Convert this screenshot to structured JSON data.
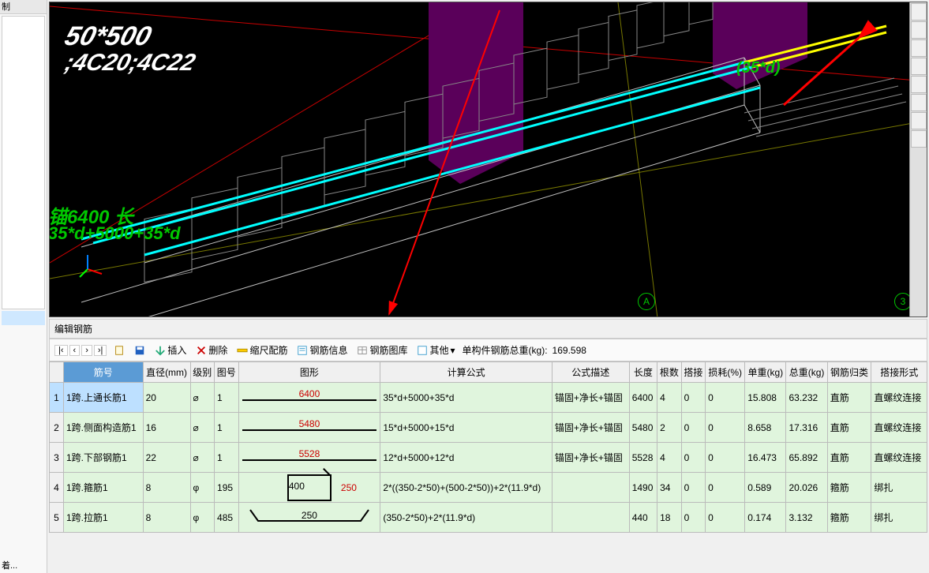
{
  "left": {
    "top_label": "制",
    "bottom_label": "着..."
  },
  "viewport": {
    "dim": "50*500",
    "rebar": ";4C20;4C22",
    "anchor_txt": "锚6400  长",
    "formula": "35*d+5000+35*d",
    "annot": "(35*d)",
    "axisA": "A",
    "axis3": "3"
  },
  "panel": {
    "title": "编辑钢筋"
  },
  "toolbar": {
    "nav": [
      "|‹",
      "‹",
      "›",
      "›|"
    ],
    "insert": "插入",
    "delete": "删除",
    "scale": "缩尺配筋",
    "info": "钢筋信息",
    "lib": "钢筋图库",
    "other": "其他",
    "weight_label": "单构件钢筋总重(kg):",
    "weight_value": "169.598"
  },
  "columns": [
    "",
    "筋号",
    "直径(mm)",
    "级别",
    "图号",
    "图形",
    "计算公式",
    "公式描述",
    "长度",
    "根数",
    "搭接",
    "损耗(%)",
    "单重(kg)",
    "总重(kg)",
    "钢筋归类",
    "搭接形式"
  ],
  "rows": [
    {
      "n": "1",
      "name": "1跨.上通长筋1",
      "dia": "20",
      "lvl": "⌀",
      "tu": "1",
      "shape": {
        "type": "line",
        "val": "6400"
      },
      "formula": "35*d+5000+35*d",
      "desc": "锚固+净长+锚固",
      "len": "6400",
      "cnt": "4",
      "lap": "0",
      "loss": "0",
      "uw": "15.808",
      "tw": "63.232",
      "cat": "直筋",
      "lapf": "直螺纹连接",
      "sel": true
    },
    {
      "n": "2",
      "name": "1跨.侧面构造筋1",
      "dia": "16",
      "lvl": "⌀",
      "tu": "1",
      "shape": {
        "type": "line",
        "val": "5480"
      },
      "formula": "15*d+5000+15*d",
      "desc": "锚固+净长+锚固",
      "len": "5480",
      "cnt": "2",
      "lap": "0",
      "loss": "0",
      "uw": "8.658",
      "tw": "17.316",
      "cat": "直筋",
      "lapf": "直螺纹连接"
    },
    {
      "n": "3",
      "name": "1跨.下部钢筋1",
      "dia": "22",
      "lvl": "⌀",
      "tu": "1",
      "shape": {
        "type": "line",
        "val": "5528"
      },
      "formula": "12*d+5000+12*d",
      "desc": "锚固+净长+锚固",
      "len": "5528",
      "cnt": "4",
      "lap": "0",
      "loss": "0",
      "uw": "16.473",
      "tw": "65.892",
      "cat": "直筋",
      "lapf": "直螺纹连接"
    },
    {
      "n": "4",
      "name": "1跨.箍筋1",
      "dia": "8",
      "lvl": "φ",
      "tu": "195",
      "shape": {
        "type": "box",
        "a": "400",
        "b": "250"
      },
      "formula": "2*((350-2*50)+(500-2*50))+2*(11.9*d)",
      "desc": "",
      "len": "1490",
      "cnt": "34",
      "lap": "0",
      "loss": "0",
      "uw": "0.589",
      "tw": "20.026",
      "cat": "箍筋",
      "lapf": "绑扎"
    },
    {
      "n": "5",
      "name": "1跨.拉筋1",
      "dia": "8",
      "lvl": "φ",
      "tu": "485",
      "shape": {
        "type": "trap",
        "val": "250"
      },
      "formula": "(350-2*50)+2*(11.9*d)",
      "desc": "",
      "len": "440",
      "cnt": "18",
      "lap": "0",
      "loss": "0",
      "uw": "0.174",
      "tw": "3.132",
      "cat": "箍筋",
      "lapf": "绑扎"
    }
  ]
}
